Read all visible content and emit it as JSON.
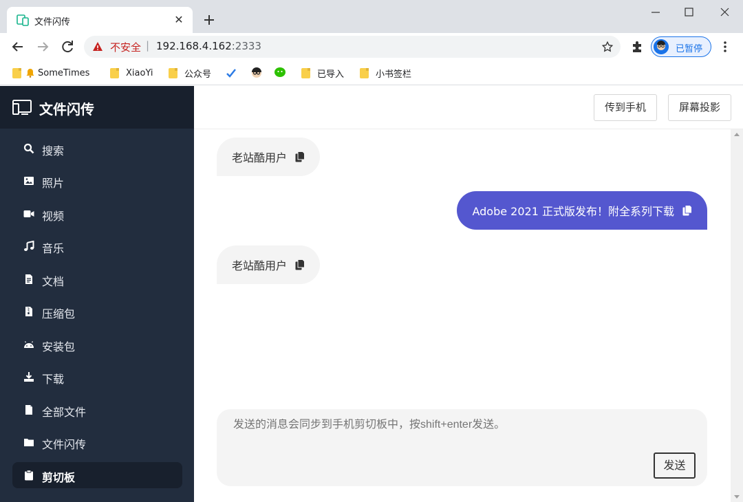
{
  "browser": {
    "tab_title": "文件闪传",
    "tab_close": "✕",
    "new_tab": "+",
    "insecure_label": "不安全",
    "url_separator": "|",
    "url_host": "192.168.4.162",
    "url_port": ":2333",
    "profile_label": "已暂停",
    "bookmarks": [
      {
        "label": "SomeTimes",
        "icon": "folder-icon"
      },
      {
        "label": "XiaoYi",
        "icon": "folder-icon"
      },
      {
        "label": "公众号",
        "icon": "folder-icon"
      },
      {
        "label": "",
        "icon": "checkmark-icon"
      },
      {
        "label": "",
        "icon": "avatar-icon"
      },
      {
        "label": "",
        "icon": "wechat-icon"
      },
      {
        "label": "已导入",
        "icon": "folder-icon"
      },
      {
        "label": "小书签栏",
        "icon": "folder-icon"
      }
    ]
  },
  "app": {
    "title": "文件闪传",
    "nav": [
      {
        "label": "搜索",
        "icon": "search-icon"
      },
      {
        "label": "照片",
        "icon": "image-icon"
      },
      {
        "label": "视频",
        "icon": "video-icon"
      },
      {
        "label": "音乐",
        "icon": "music-icon"
      },
      {
        "label": "文档",
        "icon": "document-icon"
      },
      {
        "label": "压缩包",
        "icon": "archive-icon"
      },
      {
        "label": "安装包",
        "icon": "android-icon"
      },
      {
        "label": "下载",
        "icon": "download-icon"
      },
      {
        "label": "全部文件",
        "icon": "file-icon"
      },
      {
        "label": "文件闪传",
        "icon": "folder-icon"
      },
      {
        "label": "剪切板",
        "icon": "clipboard-icon",
        "active": true
      }
    ],
    "topbar": {
      "send_to_phone": "传到手机",
      "screen_cast": "屏幕投影"
    },
    "messages": [
      {
        "text": "老站酷用户",
        "side": "left"
      },
      {
        "text": "Adobe 2021 正式版发布！附全系列下载",
        "side": "right"
      },
      {
        "text": "老站酷用户",
        "side": "left"
      }
    ],
    "composer": {
      "placeholder": "发送的消息会同步到手机剪切板中，按shift+enter发送。",
      "send_label": "发送"
    }
  },
  "colors": {
    "sidebar_bg": "#222d3e",
    "sidebar_header_bg": "#18202d",
    "accent_bubble": "#5457cf",
    "insecure_red": "#c5221f",
    "chrome_blue": "#1a73e8"
  }
}
